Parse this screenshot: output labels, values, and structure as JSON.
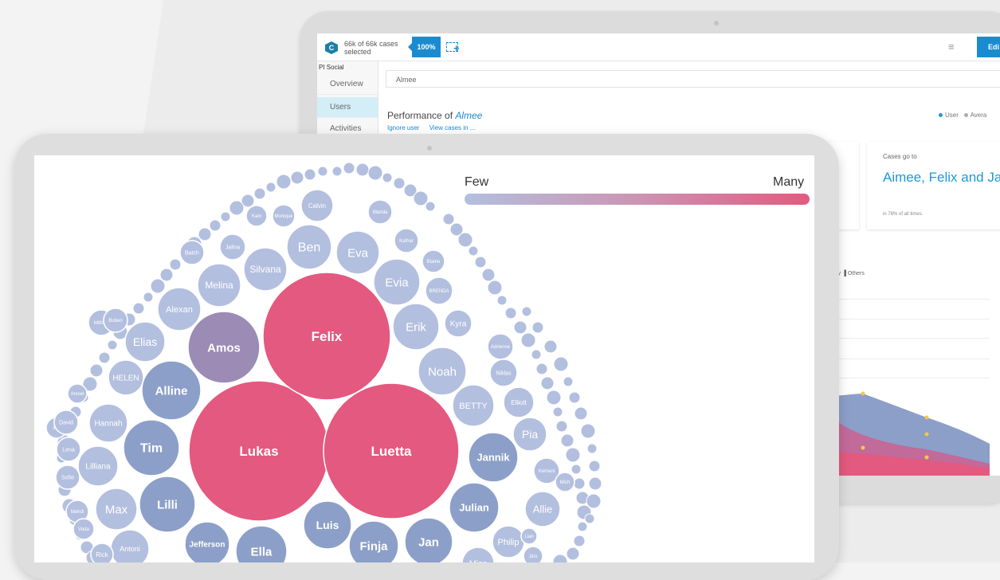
{
  "app": {
    "logo_letter": "C",
    "cases_selected": "66k of 66k cases selected",
    "percent": "100%",
    "edit_label": "Edi"
  },
  "sidebar": {
    "title": "PI Social",
    "items": [
      {
        "label": "Overview"
      },
      {
        "label": "Users"
      },
      {
        "label": "Activities"
      }
    ]
  },
  "search": {
    "value": "Almee"
  },
  "performance": {
    "title": "Performance of",
    "name": "Almee",
    "links": [
      "Ignore user",
      "View cases in ..."
    ],
    "legend": [
      "User",
      "Avera"
    ]
  },
  "card": {
    "label": "Cases go to",
    "value": "Aimee, Felix and Jan",
    "sub": "in 78% of all times."
  },
  "area_chart": {
    "header": "ity  ▐ Others"
  },
  "colors": {
    "accent": "#1b8bd0",
    "pink": "#e4597f",
    "purple": "#9b8bb5",
    "blue_dark": "#8c9fc8",
    "blue_light": "#b3bfdf"
  },
  "scale": {
    "few_label": "Few",
    "many_label": "Many"
  },
  "bubbles": [
    {
      "name": "Lukas"
    },
    {
      "name": "Luetta"
    },
    {
      "name": "Felix"
    },
    {
      "name": "Amos"
    },
    {
      "name": "Alline"
    },
    {
      "name": "Tim"
    },
    {
      "name": "Lilli"
    },
    {
      "name": "Jannik"
    },
    {
      "name": "Julian"
    },
    {
      "name": "Luis"
    },
    {
      "name": "Jan"
    },
    {
      "name": "Finja"
    },
    {
      "name": "Ella"
    },
    {
      "name": "Jefferson"
    },
    {
      "name": "Noah"
    },
    {
      "name": "Erik"
    },
    {
      "name": "Evia"
    },
    {
      "name": "Eva"
    },
    {
      "name": "Ben"
    },
    {
      "name": "Silvana"
    },
    {
      "name": "Melina"
    },
    {
      "name": "Alexan"
    },
    {
      "name": "Elias"
    },
    {
      "name": "HELEN"
    },
    {
      "name": "Hannah"
    },
    {
      "name": "Lilliana"
    },
    {
      "name": "Max"
    },
    {
      "name": "Antoni"
    },
    {
      "name": "Rick"
    },
    {
      "name": "Pia"
    },
    {
      "name": "BETTY"
    },
    {
      "name": "Allie"
    },
    {
      "name": "Philip"
    },
    {
      "name": "Elliott"
    },
    {
      "name": "Niklas"
    },
    {
      "name": "Kyra"
    },
    {
      "name": "Calvin"
    },
    {
      "name": "Wanda"
    },
    {
      "name": "Kathar"
    },
    {
      "name": "Blaine"
    },
    {
      "name": "Batch"
    },
    {
      "name": "Jalina"
    },
    {
      "name": "Miss"
    },
    {
      "name": "Jins"
    },
    {
      "name": "Ilse"
    },
    {
      "name": "David"
    },
    {
      "name": "Lena"
    },
    {
      "name": "Sofie"
    },
    {
      "name": "Mehdi"
    },
    {
      "name": "Veda"
    },
    {
      "name": "Mitford"
    },
    {
      "name": "Buben"
    },
    {
      "name": "Amsel"
    },
    {
      "name": "Kemani"
    },
    {
      "name": "Mich"
    },
    {
      "name": "Adrienne"
    },
    {
      "name": "Lian"
    },
    {
      "name": "BRENDA"
    },
    {
      "name": "Kam"
    },
    {
      "name": "Monique"
    }
  ]
}
